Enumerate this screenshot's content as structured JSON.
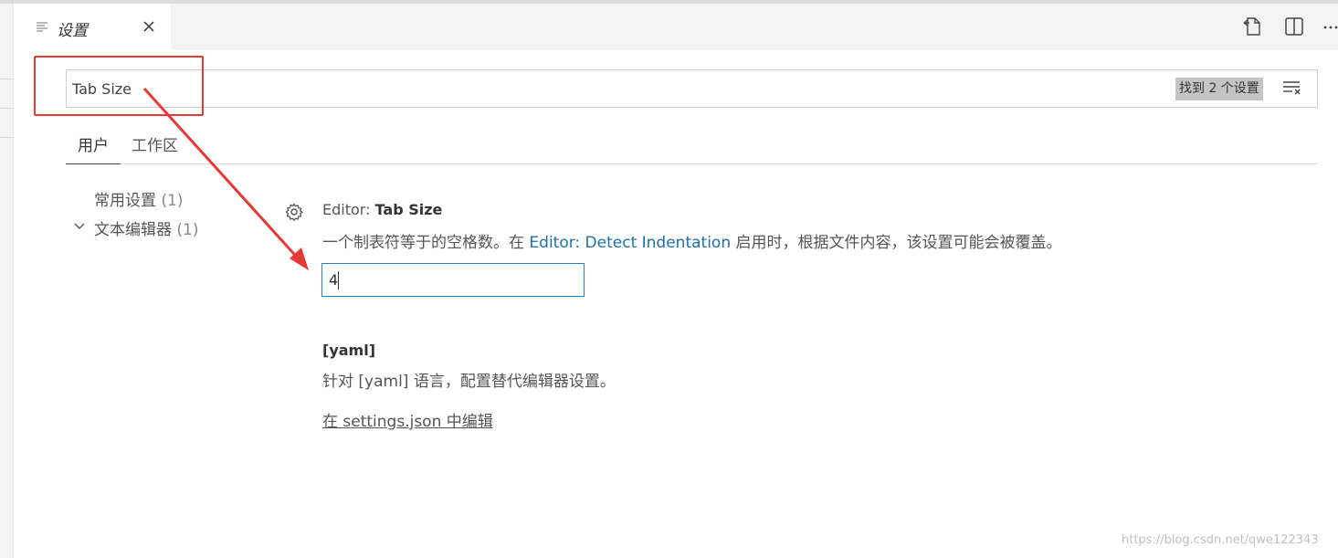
{
  "tab": {
    "title": "设置",
    "icon": "list-icon"
  },
  "editor_actions": [
    "open-json-icon",
    "split-editor-icon",
    "more-actions-icon"
  ],
  "search": {
    "value": "Tab Size",
    "result_count": "找到 2 个设置"
  },
  "scope_tabs": [
    {
      "label": "用户",
      "active": true
    },
    {
      "label": "工作区",
      "active": false
    }
  ],
  "toc": [
    {
      "label": "常用设置",
      "count": "(1)"
    },
    {
      "label": "文本编辑器",
      "count": "(1)"
    }
  ],
  "setting": {
    "category": "Editor: ",
    "name": "Tab Size",
    "desc_before": "一个制表符等于的空格数。在 ",
    "desc_link": "Editor: Detect Indentation",
    "desc_after": " 启用时，根据文件内容，该设置可能会被覆盖。",
    "value": "4"
  },
  "yaml": {
    "title": "[yaml]",
    "desc": "针对 [yaml] 语言，配置替代编辑器设置。",
    "edit_link": "在 settings.json 中编辑"
  },
  "annotation_color": "#e53935",
  "watermark": "https://blog.csdn.net/qwe122343"
}
